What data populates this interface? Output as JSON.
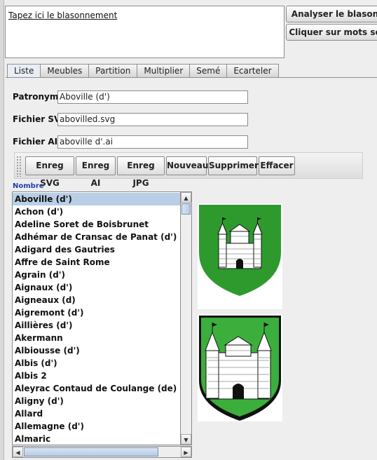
{
  "editor": {
    "placeholder": "Tapez ici le blasonnement"
  },
  "top_buttons": {
    "analyze": "Analyser le blason",
    "click_words": "Cliquer sur mots se"
  },
  "tabs": [
    "Liste",
    "Meubles",
    "Partition",
    "Multiplier",
    "Semé",
    "Ecarteler"
  ],
  "form": {
    "patronyme_label": "Patronyme",
    "patronyme_value": "Aboville (d')",
    "svg_label": "Fichier SVG",
    "svg_value": "abovilled.svg",
    "ai_label": "Fichier AI:",
    "ai_value": "aboville d'.ai"
  },
  "toolbar": [
    "Enreg SVG",
    "Enreg AI",
    "Enreg JPG",
    "Nouveau",
    "Supprimer",
    "Effacer"
  ],
  "list": {
    "header": "Nombre",
    "selected_index": 0,
    "items": [
      "Aboville (d')",
      "Achon (d')",
      "Adeline Soret de Boisbrunet",
      "Adhémar de Cransac de Panat (d')",
      "Adigard des Gautries",
      "Affre de Saint Rome",
      "Agrain (d')",
      "Aignaux (d')",
      "Aigneaux (d)",
      "Aigremont (d')",
      "Aillières (d')",
      "Akermann",
      "Albiousse (d')",
      "Albis (d')",
      "Albis 2",
      "Aleyrac Contaud de Coulange (de)",
      "Aligny (d')",
      "Allard",
      "Allemagne (d')",
      "Almaric"
    ]
  },
  "colors": {
    "shield_green": "#2e9a2e",
    "selection": "#b8cfe5"
  }
}
